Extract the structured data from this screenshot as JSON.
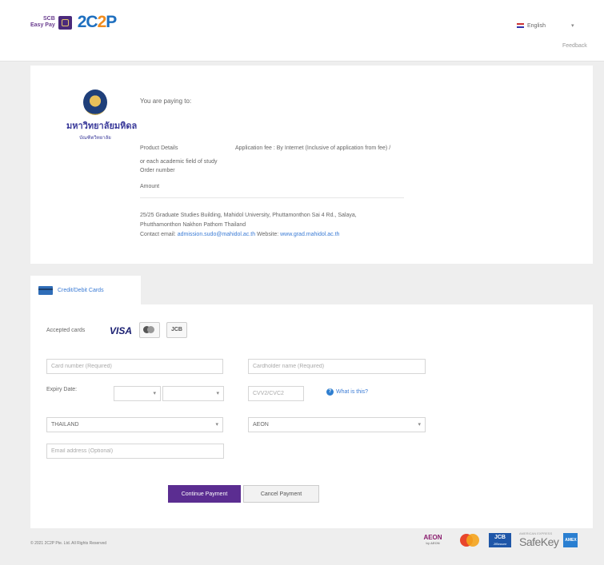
{
  "header": {
    "scb_line1": "SCB",
    "scb_line2": "Easy Pay",
    "brand_name_a": "2C",
    "brand_name_b": "2",
    "brand_name_c": "P",
    "language": "English",
    "feedback": "Feedback"
  },
  "merchant": {
    "university_name_thai": "มหาวิทยาลัยมหิดล",
    "university_sub_thai": "บัณฑิตวิทยาลัย",
    "paying_to": "You are paying to:",
    "product_details_label": "Product Details",
    "product_details_value": "Application fee : By Internet (Inclusive of application from fee) /",
    "product_details_cont": "or each academic field of study",
    "order_number_label": "Order number",
    "amount_label": "Amount",
    "address_line1": "25/25 Graduate Studies Building, Mahidol University, Phuttamonthon Sai 4 Rd., Salaya,",
    "address_line2": "Phutthamonthon Nakhon Pathom Thailand",
    "contact_label": "Contact email:",
    "contact_email": "admission.sudo@mahidol.ac.th",
    "website_label": "Website:",
    "website": "www.grad.mahidol.ac.th"
  },
  "payment_tab": {
    "label": "Credit/Debit Cards"
  },
  "form": {
    "accepted_cards_label": "Accepted cards",
    "visa_label": "VISA",
    "jcb_label": "JCB",
    "card_number_placeholder": "Card number (Required)",
    "cardholder_placeholder": "Cardholder name (Required)",
    "expiry_label": "Expiry Date:",
    "cvv_placeholder": "CVV2/CVC2",
    "what_is_this": "What is this?",
    "country_value": "THAILAND",
    "bank_value": "AEON",
    "email_placeholder": "Email address (Optional)",
    "continue_button": "Continue Payment",
    "cancel_button": "Cancel Payment"
  },
  "footer": {
    "copyright": "© 2021 2C2P Pte. Ltd. All Rights Reserved",
    "aeon": "AEON",
    "aeon_sub": "by AEON",
    "jcb": "JCB",
    "jcb_sub": "J/Secure",
    "safekey": "SafeKey",
    "safekey_sub": "AMERICAN EXPRESS",
    "amex": "AMEX"
  }
}
